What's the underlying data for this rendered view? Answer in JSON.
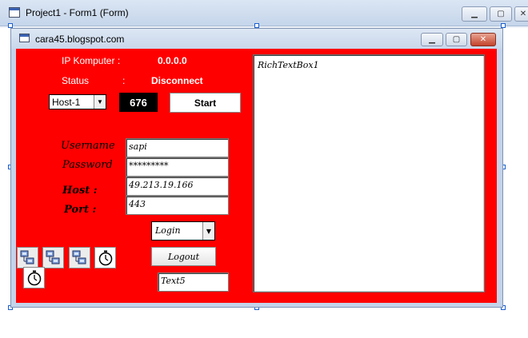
{
  "ide": {
    "title": "Project1 - Form1 (Form)",
    "buttons": {
      "minimize": "▁",
      "maximize": "▢",
      "close": "✕"
    }
  },
  "form": {
    "title": "cara45.blogspot.com",
    "buttons": {
      "minimize": "▁",
      "maximize": "▢",
      "close": "✕"
    }
  },
  "status_panel": {
    "ip_label": "IP Komputer :",
    "ip_value": "0.0.0.0",
    "status_label": "Status",
    "status_colon": ":",
    "status_value": "Disconnect"
  },
  "host_combo": {
    "value": "Host-1"
  },
  "counter": {
    "value": "676"
  },
  "start_button": {
    "label": "Start"
  },
  "login_form": {
    "username_label": "Username",
    "username_value": "sapi",
    "password_label": "Password",
    "password_value": "*********",
    "host_label": "Host :",
    "host_value": "49.213.19.166",
    "port_label": "Port :",
    "port_value": "443"
  },
  "login_combo": {
    "value": "Login"
  },
  "logout_button": {
    "label": "Logout"
  },
  "text5": {
    "value": "Text5"
  },
  "richtext": {
    "value": "RichTextBox1"
  },
  "components": [
    {
      "name": "winsock",
      "icon": "winsock-icon"
    },
    {
      "name": "winsock",
      "icon": "winsock-icon"
    },
    {
      "name": "winsock",
      "icon": "winsock-icon"
    },
    {
      "name": "timer",
      "icon": "timer-icon"
    },
    {
      "name": "timer",
      "icon": "timer-icon"
    }
  ],
  "colors": {
    "form_background": "#ff0000",
    "ide_titlebar": "#c5d5ea",
    "counter_background": "#000000"
  }
}
